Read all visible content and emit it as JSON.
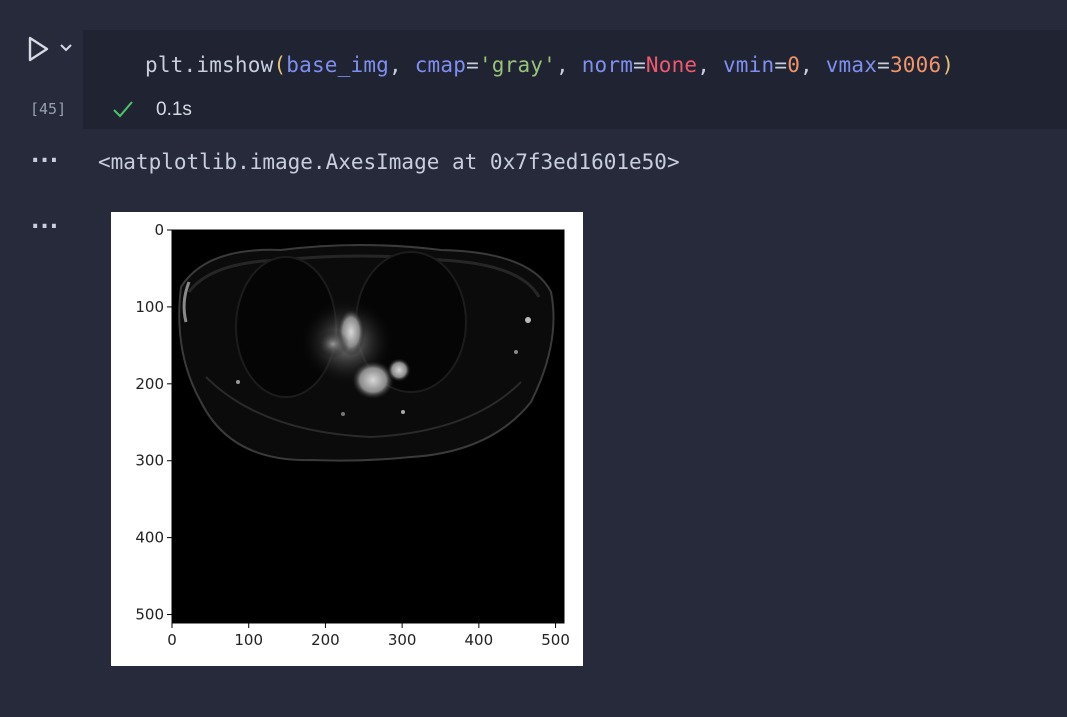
{
  "cell": {
    "execution_count": "[45]",
    "code_tokens": [
      {
        "text": "plt.imshow",
        "type": "fn"
      },
      {
        "text": "(",
        "type": "bracket"
      },
      {
        "text": "base_img",
        "type": "param"
      },
      {
        "text": ", ",
        "type": "plain"
      },
      {
        "text": "cmap",
        "type": "param"
      },
      {
        "text": "=",
        "type": "plain"
      },
      {
        "text": "'gray'",
        "type": "str"
      },
      {
        "text": ", ",
        "type": "plain"
      },
      {
        "text": "norm",
        "type": "param"
      },
      {
        "text": "=",
        "type": "plain"
      },
      {
        "text": "None",
        "type": "kw"
      },
      {
        "text": ", ",
        "type": "plain"
      },
      {
        "text": "vmin",
        "type": "param"
      },
      {
        "text": "=",
        "type": "plain"
      },
      {
        "text": "0",
        "type": "num"
      },
      {
        "text": ", ",
        "type": "plain"
      },
      {
        "text": "vmax",
        "type": "param"
      },
      {
        "text": "=",
        "type": "plain"
      },
      {
        "text": "3006",
        "type": "num"
      },
      {
        "text": ")",
        "type": "bracket"
      }
    ],
    "status": "success",
    "duration": "0.1s"
  },
  "outputs": {
    "text_output": "<matplotlib.image.AxesImage at 0x7f3ed1601e50>",
    "more_glyph": "..."
  },
  "colors": {
    "background": "#262a3a",
    "input_background": "#1f2332",
    "success": "#4ec26b"
  },
  "chart_data": {
    "type": "image",
    "colormap": "gray",
    "xlim": [
      0,
      511
    ],
    "ylim": [
      511,
      0
    ],
    "xticks": [
      "0",
      "100",
      "200",
      "300",
      "400",
      "500"
    ],
    "yticks": [
      "0",
      "100",
      "200",
      "300",
      "400",
      "500"
    ],
    "xtick_values": [
      0,
      100,
      200,
      300,
      400,
      500
    ],
    "ytick_values": [
      0,
      100,
      200,
      300,
      400,
      500
    ]
  }
}
